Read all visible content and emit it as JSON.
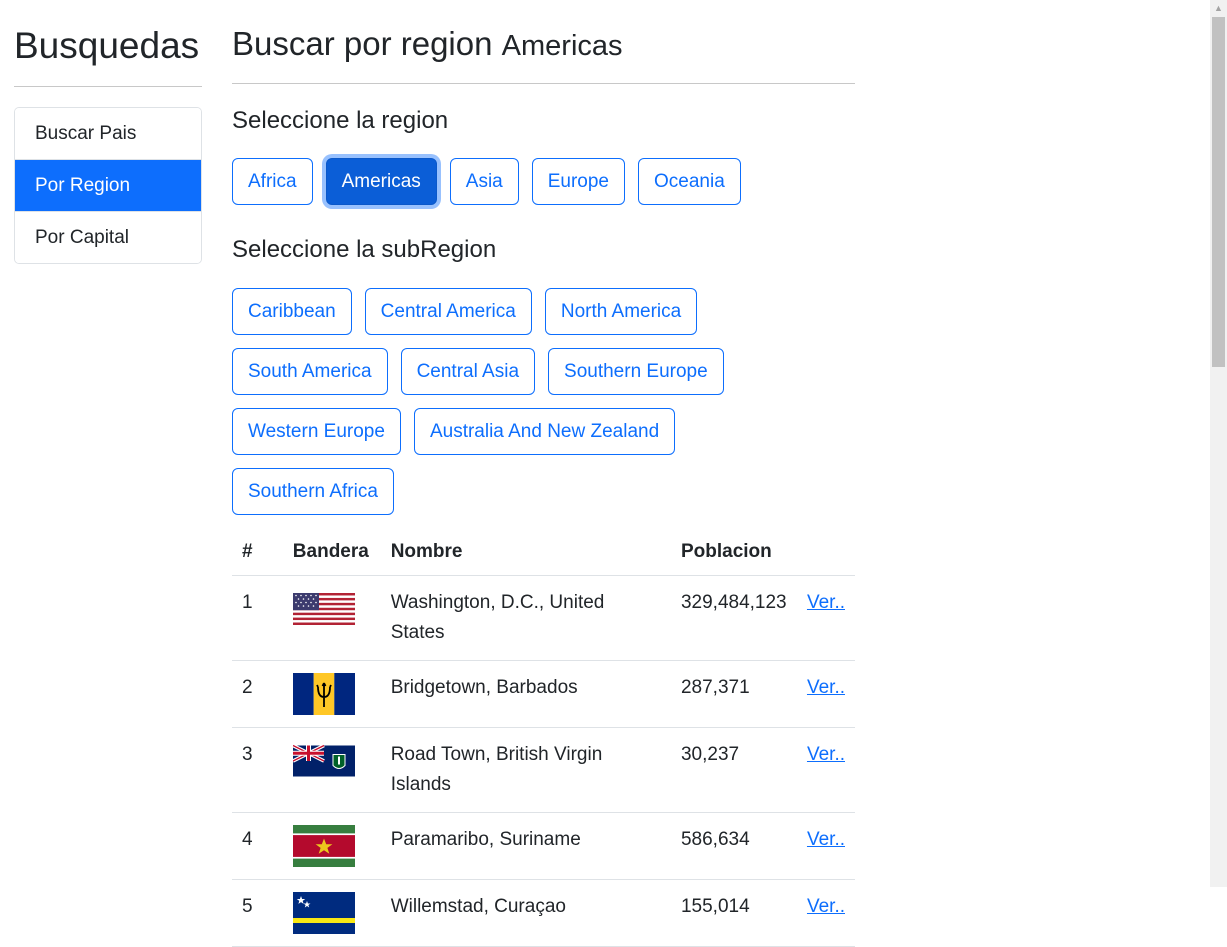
{
  "sidebar": {
    "title": "Busquedas",
    "items": [
      {
        "label": "Buscar Pais"
      },
      {
        "label": "Por Region"
      },
      {
        "label": "Por Capital"
      }
    ]
  },
  "main": {
    "title": "Buscar por region",
    "title_region": "Americas",
    "region_heading": "Seleccione la region",
    "regions": [
      "Africa",
      "Americas",
      "Asia",
      "Europe",
      "Oceania"
    ],
    "active_region": "Americas",
    "subregion_heading": "Seleccione la subRegion",
    "subregions": [
      "Caribbean",
      "Central America",
      "North America",
      "South America",
      "Central Asia",
      "Southern Europe",
      "Western Europe",
      "Australia And New Zealand",
      "Southern Africa"
    ]
  },
  "table": {
    "headers": [
      "#",
      "Bandera",
      "Nombre",
      "Poblacion",
      ""
    ],
    "rows": [
      {
        "num": "1",
        "flag": "flag-united-states-icon",
        "name": "Washington, D.C., United States",
        "population": "329,484,123",
        "link": "Ver.."
      },
      {
        "num": "2",
        "flag": "flag-barbados-icon",
        "name": "Bridgetown, Barbados",
        "population": "287,371",
        "link": "Ver.."
      },
      {
        "num": "3",
        "flag": "flag-british-virgin-islands-icon",
        "name": "Road Town, British Virgin Islands",
        "population": "30,237",
        "link": "Ver.."
      },
      {
        "num": "4",
        "flag": "flag-suriname-icon",
        "name": "Paramaribo, Suriname",
        "population": "586,634",
        "link": "Ver.."
      },
      {
        "num": "5",
        "flag": "flag-curacao-icon",
        "name": "Willemstad, Curaçao",
        "population": "155,014",
        "link": "Ver.."
      }
    ]
  },
  "colors": {
    "accent": "#0d6efd",
    "active_button": "#0b5ed7",
    "text": "#212529"
  }
}
